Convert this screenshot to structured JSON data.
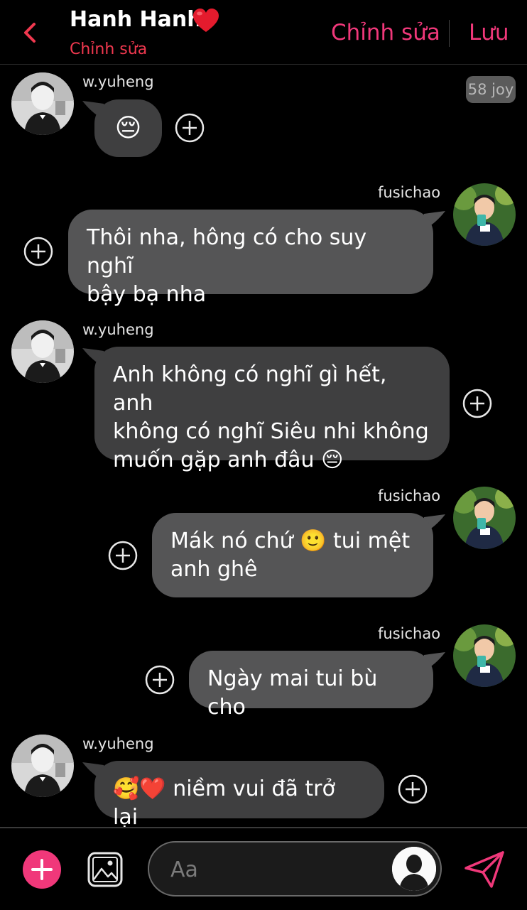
{
  "header": {
    "title": "Hanh Hanh",
    "subtitle": "Chỉnh sửa",
    "edit_label": "Chỉnh sửa",
    "save_label": "Lưu",
    "accent_color": "#f0387a"
  },
  "timestamp_badge": "58 joy",
  "messages": [
    {
      "sender": "w.yuheng",
      "side": "left",
      "text": "😔"
    },
    {
      "sender": "fusichao",
      "side": "right",
      "lines": [
        "Thôi nha, hông có cho suy nghĩ",
        "bậy bạ nha"
      ]
    },
    {
      "sender": "w.yuheng",
      "side": "left",
      "lines": [
        "Anh không có nghĩ gì hết, anh",
        "không có nghĩ Siêu nhi không",
        "muốn gặp anh đâu 😔"
      ]
    },
    {
      "sender": "fusichao",
      "side": "right",
      "lines": [
        "Mák nó chứ 🙂 tui mệt",
        "anh ghê"
      ]
    },
    {
      "sender": "fusichao",
      "side": "right",
      "text": "Ngày mai tui bù cho"
    },
    {
      "sender": "w.yuheng",
      "side": "left",
      "text": "🥰❤️ niềm vui đã trở lại"
    }
  ],
  "composer": {
    "placeholder": "Aa"
  },
  "icons": {
    "back": "chevron-left-icon",
    "add": "plus-icon",
    "image": "image-icon",
    "send": "send-icon",
    "react": "add-reaction-icon"
  }
}
